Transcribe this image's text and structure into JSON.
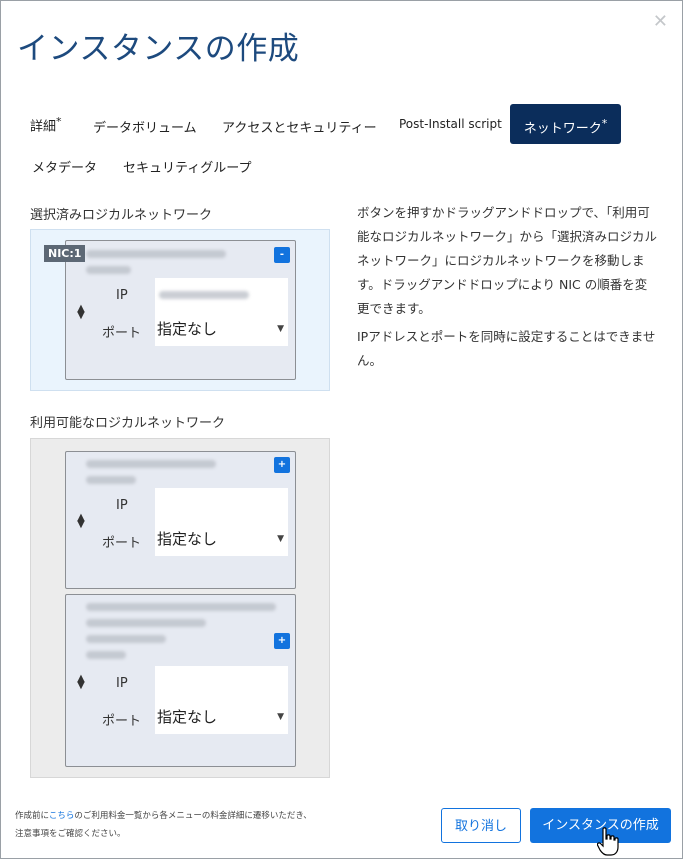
{
  "dialog": {
    "title": "インスタンスの作成",
    "close_icon": "✕"
  },
  "tabs": [
    {
      "label": "詳細",
      "required_mark": "*",
      "active": false
    },
    {
      "label": "データボリューム",
      "required_mark": "",
      "active": false
    },
    {
      "label": "アクセスとセキュリティー",
      "required_mark": "",
      "active": false
    },
    {
      "label": "Post-Install script",
      "required_mark": "",
      "active": false
    },
    {
      "label": "ネットワーク",
      "required_mark": "*",
      "active": true
    },
    {
      "label": "メタデータ",
      "required_mark": "",
      "active": false
    },
    {
      "label": "セキュリティグループ",
      "required_mark": "",
      "active": false
    }
  ],
  "selected": {
    "label": "選択済みロジカルネットワーク",
    "networks": [
      {
        "nic": "NIC:1",
        "button": "-",
        "ip_label": "IP",
        "port_label": "ポート",
        "port_value": "指定なし"
      }
    ]
  },
  "available": {
    "label": "利用可能なロジカルネットワーク",
    "networks": [
      {
        "button": "+",
        "ip_label": "IP",
        "port_label": "ポート",
        "port_value": "指定なし"
      },
      {
        "button": "+",
        "ip_label": "IP",
        "port_label": "ポート",
        "port_value": "指定なし"
      }
    ]
  },
  "help": {
    "paragraph1": "ボタンを押すかドラッグアンドドロップで、「利用可能なロジカルネットワーク」から「選択済みロジカルネットワーク」にロジカルネットワークを移動します。ドラッグアンドドロップにより NIC の順番を変更できます。",
    "paragraph2": "IPアドレスとポートを同時に設定することはできません。"
  },
  "footer": {
    "note_prefix": "作成前に",
    "note_link": "こちら",
    "note_suffix": "のご利用料金一覧から各メニューの料金詳細に遷移いただき、",
    "note_line2": "注意事項をご確認ください。",
    "cancel_label": "取り消し",
    "create_label": "インスタンスの作成"
  },
  "icons": {
    "drag_handle": "drag-handle-icon",
    "select_caret": "caret-down-icon",
    "cursor": "hand-pointer-icon"
  },
  "colors": {
    "title": "#1d4a7e",
    "active_tab_bg": "#0b2d5b",
    "primary": "#1273de",
    "selected_zone_bg": "#eaf4fd",
    "available_zone_bg": "#ececec",
    "card_bg": "#e6eaf2"
  }
}
